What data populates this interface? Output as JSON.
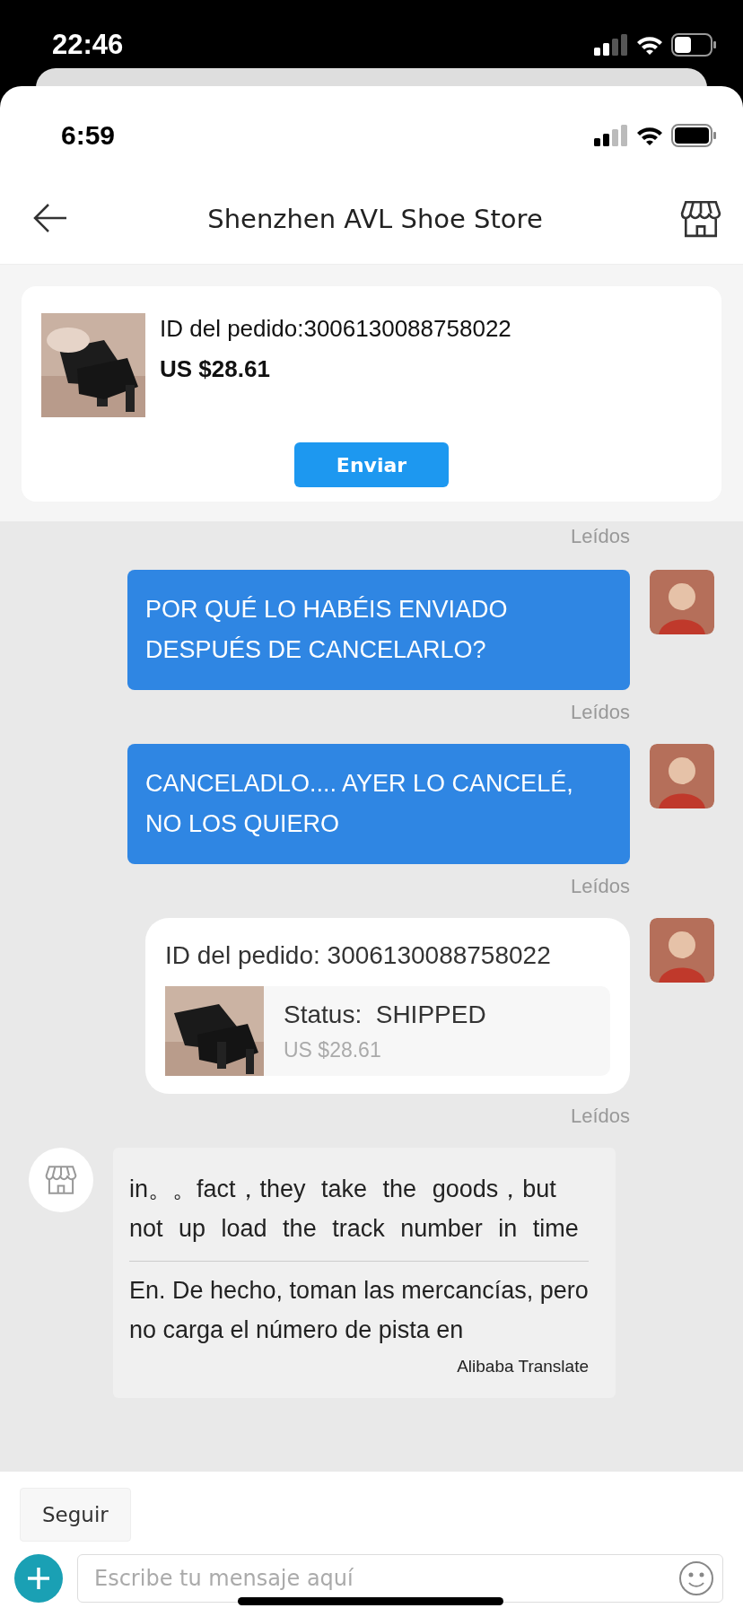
{
  "device_status": {
    "time": "22:46"
  },
  "app_status": {
    "time": "6:59"
  },
  "header": {
    "title": "Shenzhen AVL Shoe Store"
  },
  "order_card": {
    "order_id": "ID del pedido:3006130088758022",
    "price": "US $28.61",
    "button": "Enviar"
  },
  "top_receipt": "Leídos",
  "messages": [
    {
      "kind": "text",
      "outgoing": true,
      "text": "POR QUÉ LO HABÉIS ENVIADO DESPUÉS DE CANCELARLO?",
      "receipt": "Leídos"
    },
    {
      "kind": "text",
      "outgoing": true,
      "text": "CANCELADLO.... AYER LO CANCELÉ, NO LOS QUIERO",
      "receipt": "Leídos"
    },
    {
      "kind": "order",
      "outgoing": true,
      "order_id": "ID del pedido: 3006130088758022",
      "status_label": "Status:",
      "status": "SHIPPED",
      "price": "US $28.61",
      "receipt": "Leídos"
    },
    {
      "kind": "translated",
      "outgoing": false,
      "original": "in。。fact，they take the goods，but not up load the track number in time",
      "translation": "En. De hecho, toman las mercancías, pero no carga el número de pista en",
      "credit": "Alibaba Translate"
    }
  ],
  "follow_button": "Seguir",
  "composer": {
    "placeholder": "Escribe tu mensaje aquí"
  }
}
